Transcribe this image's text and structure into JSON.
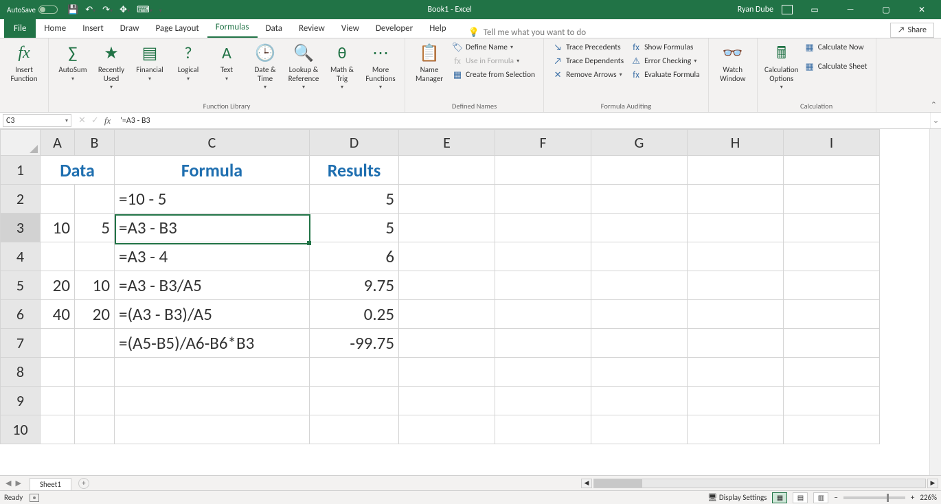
{
  "app": {
    "autosave_label": "AutoSave",
    "title": "Book1 - Excel",
    "user": "Ryan Dube"
  },
  "tabs": {
    "file": "File",
    "home": "Home",
    "insert": "Insert",
    "draw": "Draw",
    "page_layout": "Page Layout",
    "formulas": "Formulas",
    "data": "Data",
    "review": "Review",
    "view": "View",
    "developer": "Developer",
    "help": "Help",
    "tellme": "Tell me what you want to do",
    "share": "Share"
  },
  "ribbon": {
    "insert_function": "Insert\nFunction",
    "autosum": "AutoSum",
    "recently_used": "Recently\nUsed",
    "financial": "Financial",
    "logical": "Logical",
    "text": "Text",
    "date_time": "Date &\nTime",
    "lookup_ref": "Lookup &\nReference",
    "math_trig": "Math &\nTrig",
    "more_functions": "More\nFunctions",
    "function_library": "Function Library",
    "name_manager": "Name\nManager",
    "define_name": "Define Name",
    "use_in_formula": "Use in Formula",
    "create_from_selection": "Create from Selection",
    "defined_names": "Defined Names",
    "trace_precedents": "Trace Precedents",
    "trace_dependents": "Trace Dependents",
    "remove_arrows": "Remove Arrows",
    "show_formulas": "Show Formulas",
    "error_checking": "Error Checking",
    "evaluate_formula": "Evaluate Formula",
    "formula_auditing": "Formula Auditing",
    "watch_window": "Watch\nWindow",
    "calculation_options": "Calculation\nOptions",
    "calculate_now": "Calculate Now",
    "calculate_sheet": "Calculate Sheet",
    "calculation": "Calculation"
  },
  "cell_ref": {
    "name": "C3",
    "formula": "'=A3 - B3"
  },
  "columns": [
    "A",
    "B",
    "C",
    "D",
    "E",
    "F",
    "G",
    "H",
    "I"
  ],
  "rows": [
    "1",
    "2",
    "3",
    "4",
    "5",
    "6",
    "7",
    "8",
    "9",
    "10"
  ],
  "data": {
    "r1": {
      "A": "",
      "B": "",
      "C": "Formula",
      "D": "Results",
      "AB_merged": "Data"
    },
    "r2": {
      "A": "",
      "B": "",
      "C": "=10 - 5",
      "D": "5"
    },
    "r3": {
      "A": "10",
      "B": "5",
      "C": "=A3 - B3",
      "D": "5"
    },
    "r4": {
      "A": "",
      "B": "",
      "C": "=A3 - 4",
      "D": "6"
    },
    "r5": {
      "A": "20",
      "B": "10",
      "C": "=A3 - B3/A5",
      "D": "9.75"
    },
    "r6": {
      "A": "40",
      "B": "20",
      "C": "=(A3 - B3)/A5",
      "D": "0.25"
    },
    "r7": {
      "A": "",
      "B": "",
      "C": "=(A5-B5)/A6-B6*B3",
      "D": "-99.75"
    }
  },
  "sheet": {
    "name": "Sheet1"
  },
  "status": {
    "ready": "Ready",
    "display_settings": "Display Settings",
    "zoom": "226%"
  }
}
